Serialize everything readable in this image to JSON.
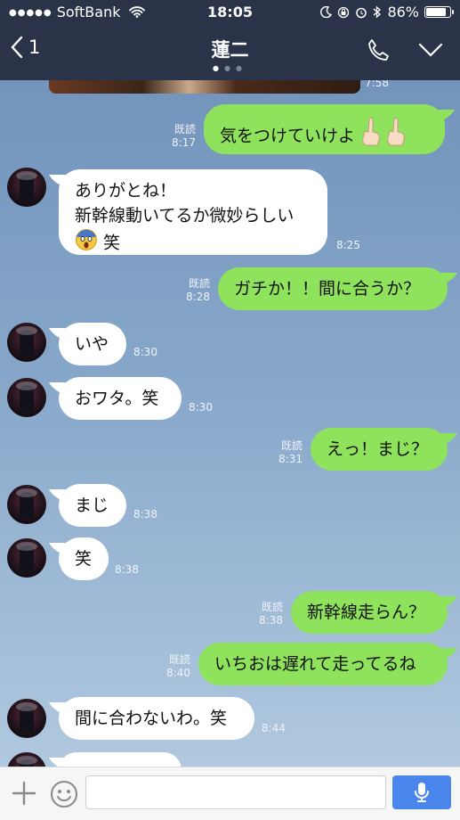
{
  "status": {
    "carrier": "SoftBank",
    "time": "18:05",
    "battery": "86%",
    "battery_fill": 0.86
  },
  "nav": {
    "back_count": "1",
    "title": "蓮二"
  },
  "messages": {
    "m0_time": "7:58",
    "m1": {
      "read": "既読",
      "time": "8:17",
      "text": "気をつけていけよ"
    },
    "m2": {
      "line1": "ありがとね！",
      "line2": "新幹線動いてるか微妙らしい",
      "line3": "笑",
      "time": "8:25"
    },
    "m3": {
      "read": "既読",
      "time": "8:28",
      "text": "ガチか！！間に合うか？"
    },
    "m4": {
      "text": "いや",
      "time": "8:30"
    },
    "m5": {
      "text": "おワタ。笑",
      "time": "8:30"
    },
    "m6": {
      "read": "既読",
      "time": "8:31",
      "text": "えっ！まじ？"
    },
    "m7": {
      "text": "まじ",
      "time": "8:38"
    },
    "m8": {
      "text": "笑",
      "time": "8:38"
    },
    "m9": {
      "read": "既読",
      "time": "8:38",
      "text": "新幹線走らん？"
    },
    "m10": {
      "read": "既読",
      "time": "8:40",
      "text": "いちおは遅れて走ってるね"
    },
    "m11": {
      "text": "間に合わないわ。笑",
      "time": "8:44"
    }
  },
  "icons": [
    "back-icon",
    "phone-icon",
    "chevron-down-icon",
    "plus-icon",
    "smile-icon",
    "mic-icon",
    "wifi-icon",
    "moon-icon",
    "lock-rotation-icon",
    "alarm-icon",
    "bluetooth-icon",
    "battery-icon",
    "scream-emoji",
    "pointing-up-emoji"
  ],
  "colors": {
    "header": "#2a3347",
    "outgoing": "#8fe25b",
    "incoming": "#ffffff",
    "send": "#4b86ec"
  }
}
